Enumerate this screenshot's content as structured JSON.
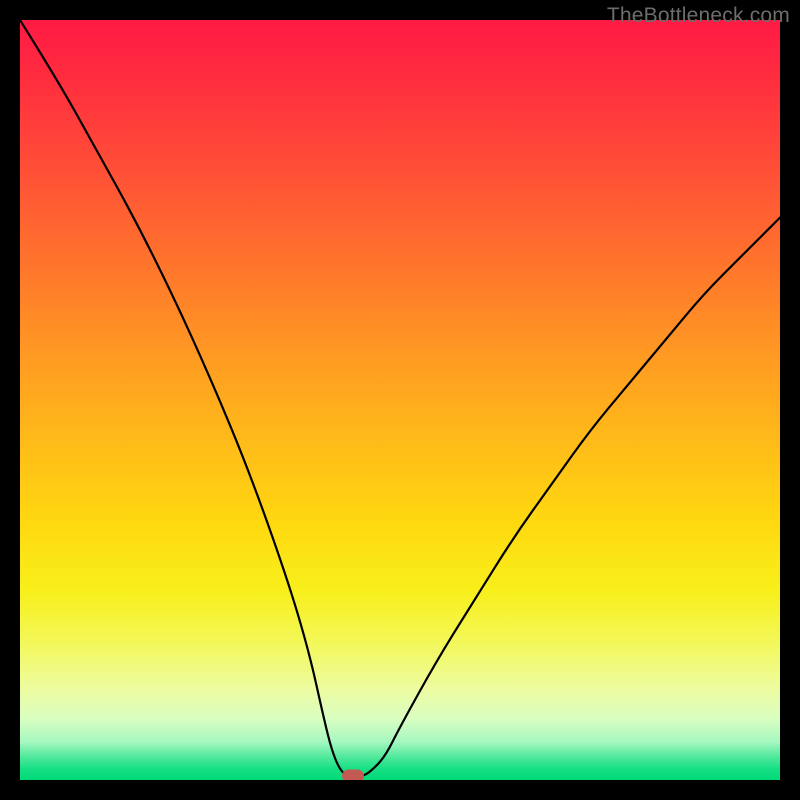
{
  "watermark": {
    "text": "TheBottleneck.com"
  },
  "chart_data": {
    "type": "line",
    "title": "",
    "xlabel": "",
    "ylabel": "",
    "xlim": [
      0,
      100
    ],
    "ylim": [
      0,
      100
    ],
    "x": [
      0,
      5,
      10,
      15,
      20,
      25,
      30,
      35,
      38,
      40,
      41,
      42,
      43,
      44,
      45,
      46,
      48,
      50,
      55,
      60,
      65,
      70,
      75,
      80,
      85,
      90,
      95,
      100
    ],
    "values": [
      100,
      92,
      83,
      74,
      64,
      53,
      41,
      27,
      17,
      8,
      4,
      1.5,
      0.5,
      0.5,
      0.5,
      1,
      3,
      7,
      16,
      24,
      32,
      39,
      46,
      52,
      58,
      64,
      69,
      74
    ],
    "marker": {
      "x": 43.8,
      "y": 0.5,
      "color": "#c25a52"
    },
    "background": "red-yellow-green vertical gradient",
    "annotations": []
  }
}
